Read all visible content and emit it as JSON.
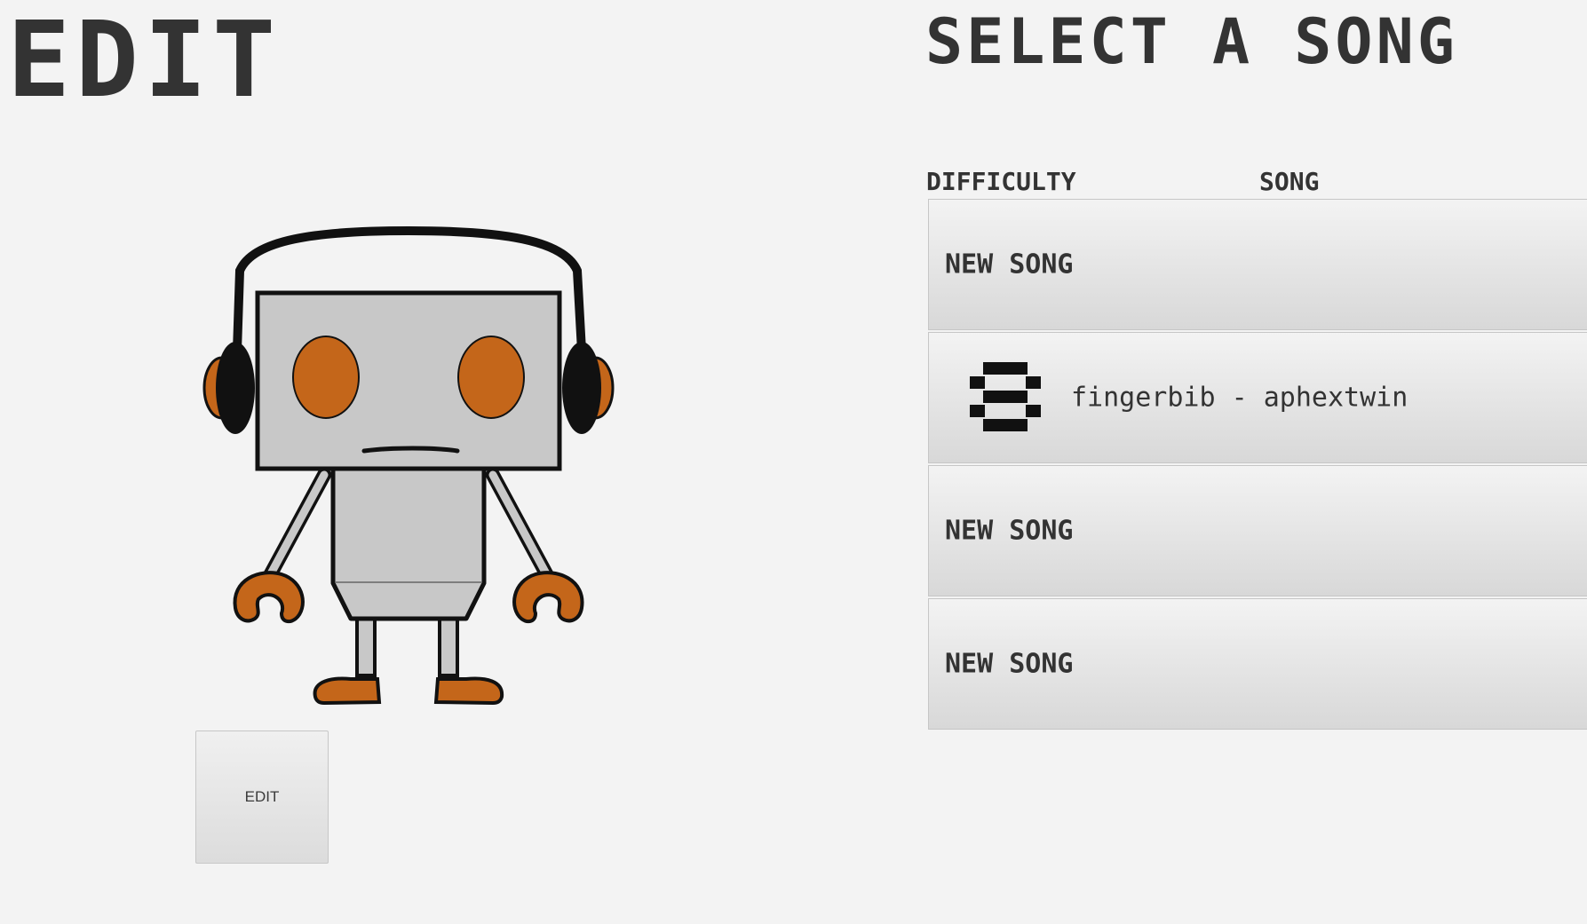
{
  "page": {
    "title": "EDIT",
    "select_title": "SELECT A SONG"
  },
  "robot": {
    "icon": "robot-with-headphones-icon",
    "colors": {
      "body": "#c8c8c8",
      "accent": "#c4661a",
      "outline": "#111111"
    }
  },
  "edit_button": {
    "label": "EDIT"
  },
  "song_table": {
    "headers": {
      "difficulty": "DIFFICULTY",
      "song": "SONG"
    },
    "rows": [
      {
        "type": "new",
        "label": "NEW SONG"
      },
      {
        "type": "song",
        "difficulty": "8",
        "title": "fingerbib - aphextwin"
      },
      {
        "type": "new",
        "label": "NEW SONG"
      },
      {
        "type": "new",
        "label": "NEW SONG"
      }
    ]
  }
}
